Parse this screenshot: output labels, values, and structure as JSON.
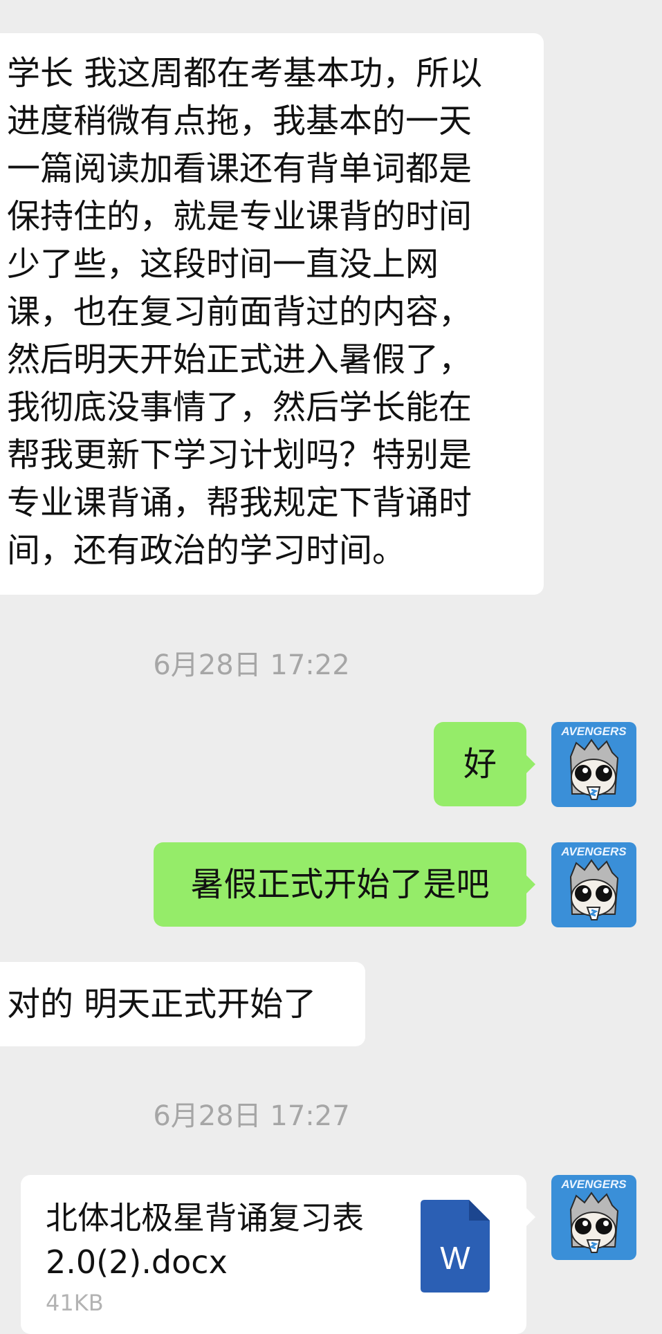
{
  "messages": {
    "m1_lines": [
      "学长 我这周都在考基本功，所以",
      "进度稍微有点拖，我基本的一天",
      "一篇阅读加看课还有背单词都是",
      "保持住的，就是专业课背的时间",
      "少了些，这段时间一直没上网",
      "课，也在复习前面背过的内容，",
      "然后明天开始正式进入暑假了，",
      "我彻底没事情了，然后学长能在",
      "帮我更新下学习计划吗？特别是",
      "专业课背诵，帮我规定下背诵时",
      "间，还有政治的学习时间。"
    ],
    "timestamp1": "6月28日 17:22",
    "m2_text": "好",
    "m3_text": "暑假正式开始了是吧",
    "m4_text": "对的 明天正式开始了",
    "timestamp2": "6月28日 17:27",
    "file": {
      "name": "北体北极星背诵复习表 2.0(2).docx",
      "size": "41KB",
      "icon": "word-doc-icon",
      "icon_letter": "W"
    }
  },
  "avatar": {
    "brand": "AVENGERS",
    "color": "#3a8fd8"
  },
  "colors": {
    "self_bubble": "#95ec69",
    "other_bubble": "#ffffff",
    "background": "#ededed"
  }
}
